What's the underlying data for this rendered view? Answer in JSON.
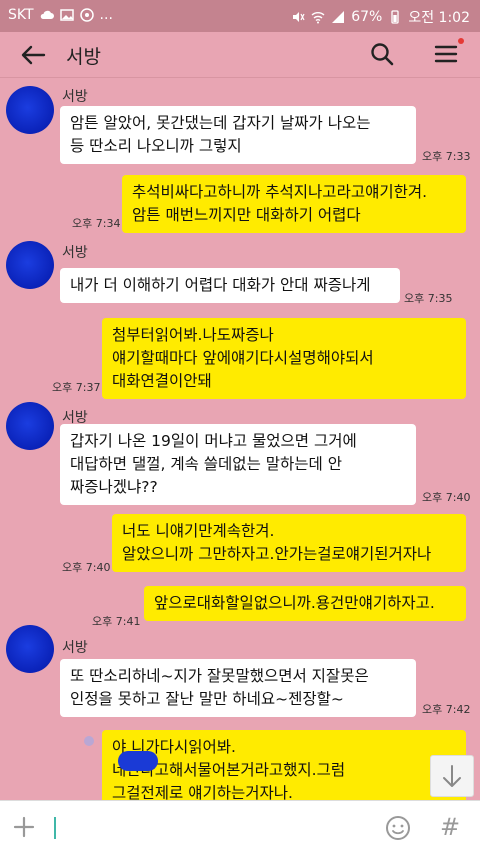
{
  "status": {
    "carrier": "SKT",
    "more": "...",
    "battery": "67%",
    "time": "오전 1:02"
  },
  "header": {
    "title": "서방"
  },
  "messages": [
    {
      "side": "in",
      "sender": "서방",
      "text": "암튼 알았어, 못간댔는데 갑자기 날짜가 나오는\n등 딴소리 나오니까 그렇지",
      "time": "오후 7:33"
    },
    {
      "side": "out",
      "text": "추석비싸다고하니까 추석지나고라고얘기한겨.\n암튼 매번느끼지만 대화하기 어렵다",
      "time": "오후 7:34"
    },
    {
      "side": "in",
      "sender": "서방",
      "text": "내가 더 이해하기 어렵다 대화가 안대 짜증나게",
      "time": "오후 7:35"
    },
    {
      "side": "out",
      "text": "첨부터읽어봐.나도짜증나\n얘기할때마다 앞에얘기다시설명해야되서\n대화연결이안돼",
      "time": "오후 7:37"
    },
    {
      "side": "in",
      "sender": "서방",
      "text": "갑자기 나온 19일이 머냐고 물었으면 그거에\n대답하면 댈껄, 계속 쓸데없는 말하는데 안\n짜증나겠냐??",
      "time": "오후 7:40"
    },
    {
      "side": "out",
      "text": "너도 니얘기만계속한겨.\n알았으니까 그만하자고.안가는걸로얘기된거자나",
      "time": "오후 7:40"
    },
    {
      "side": "out",
      "text": "앞으로대화할일없으니까.용건만얘기하자고.",
      "time": "오후 7:41"
    },
    {
      "side": "in",
      "sender": "서방",
      "text": "또 딴소리하네~지가 잘못말했으면서 지잘못은\n인정을 못하고 잘난 말만 하네요~젠장할~",
      "time": "오후 7:42"
    },
    {
      "side": "out",
      "text": "야 니가다시읽어봐.\n       네간다고해서물어본거라고했지.그럼\n그걸전제로 얘기하는거자나.",
      "time": ""
    }
  ],
  "input": {
    "placeholder": ""
  },
  "icons": {
    "back": "back-arrow-icon",
    "search": "search-icon",
    "menu": "hamburger-menu-icon",
    "plus": "plus-icon",
    "emoji": "emoji-icon",
    "sharp": "#",
    "scroll_down": "arrow-down-icon"
  },
  "colors": {
    "chat_bg": "#e8a5b3",
    "incoming_bubble": "#ffffff",
    "outgoing_bubble": "#ffeb00",
    "status_bar": "#c4838f",
    "notification_dot": "#e53935"
  }
}
